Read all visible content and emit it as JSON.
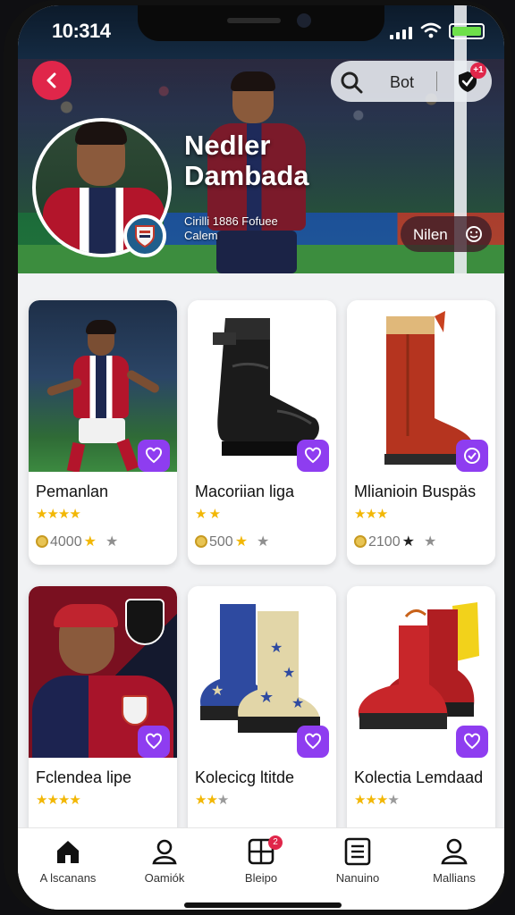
{
  "status_bar": {
    "time": "10:314"
  },
  "header": {
    "search_text": "Bot",
    "notification_badge": "+1",
    "player_name": "Nedler Dambada",
    "player_sub": "Cirilli 1886 Fofuee Calem",
    "action_button": "Nilen"
  },
  "cards": [
    {
      "title": "Pemanlan",
      "rating": 4,
      "rating_shown": 4,
      "price": "4000",
      "price_visible": true
    },
    {
      "title": "Macoriian liga",
      "rating": 2,
      "rating_shown": 2,
      "price": "500",
      "price_visible": true
    },
    {
      "title": "Mlianioin Buspäs",
      "rating": 3,
      "rating_shown": 3,
      "price": "2100",
      "price_visible": true
    },
    {
      "title": "Fclendea lipe",
      "rating": 4,
      "rating_shown": 4,
      "price": "",
      "price_visible": false
    },
    {
      "title": "Kolecicg ltitde",
      "rating": 2,
      "rating_shown": 3,
      "price": "",
      "price_visible": false
    },
    {
      "title": "Kolectia Lemdaad",
      "rating": 3,
      "rating_shown": 4,
      "price": "",
      "price_visible": false
    }
  ],
  "bottom_nav": [
    {
      "label": "A lscanans",
      "icon": "home-icon"
    },
    {
      "label": "Oamiók",
      "icon": "profile-icon"
    },
    {
      "label": "Bleipo",
      "icon": "grid-icon",
      "badge": "2"
    },
    {
      "label": "Nanuino",
      "icon": "list-icon"
    },
    {
      "label": "Mallians",
      "icon": "account-icon"
    }
  ],
  "colors": {
    "accent_red": "#e0264a",
    "accent_purple": "#8e3df0",
    "star": "#f2b705"
  }
}
